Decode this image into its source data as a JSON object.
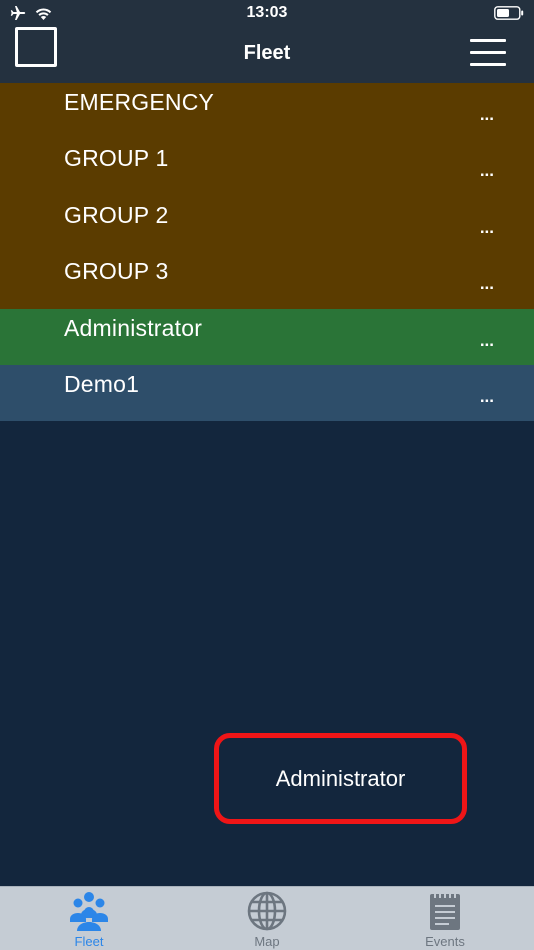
{
  "status_bar": {
    "time": "13:03",
    "icons": [
      "airplane-icon",
      "wifi-icon",
      "battery-icon"
    ]
  },
  "nav": {
    "title": "Fleet",
    "menu_icon": "hamburger-menu-icon"
  },
  "groups": [
    {
      "label": "EMERGENCY",
      "more": "...",
      "color": "#5b3c00"
    },
    {
      "label": "GROUP 1",
      "more": "...",
      "color": "#5b3c00"
    },
    {
      "label": "GROUP 2",
      "more": "...",
      "color": "#5b3c00"
    },
    {
      "label": "GROUP 3",
      "more": "...",
      "color": "#5b3c00"
    },
    {
      "label": "Administrator",
      "more": "...",
      "color": "#2a7437"
    },
    {
      "label": "Demo1",
      "more": "...",
      "color": "#2e4e6a"
    }
  ],
  "popup": {
    "label": "Administrator",
    "border_color": "#ef1517"
  },
  "tabs": [
    {
      "label": "Fleet",
      "icon": "people-group-icon",
      "active": true,
      "color": "#2c86e8"
    },
    {
      "label": "Map",
      "icon": "globe-icon",
      "active": false,
      "color": "#6d7680"
    },
    {
      "label": "Events",
      "icon": "notepad-icon",
      "active": false,
      "color": "#6d7680"
    }
  ],
  "colors": {
    "background": "#13263d",
    "bar": "#24313f",
    "tabbar": "#c5ccd4"
  }
}
